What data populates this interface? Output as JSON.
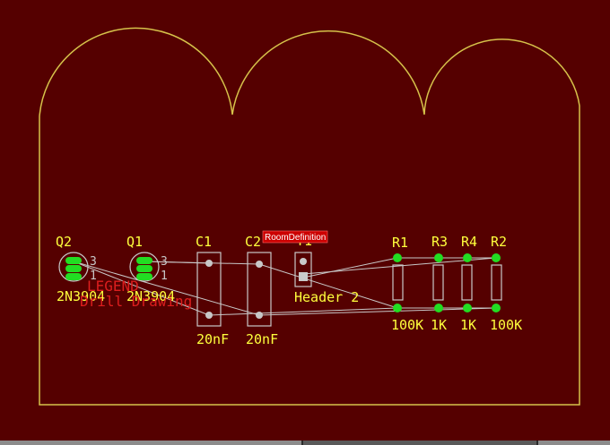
{
  "colors": {
    "background": "#550000",
    "board_outline": "#d6c24a",
    "silkscreen": "#ffff3c",
    "pad_green": "#22dd22",
    "pad_grey": "#c8c8c8",
    "trace": "#c8c8c8",
    "legend_red": "#dd1e1e",
    "tag_bg": "#cc0000"
  },
  "tooltip": {
    "label": "RoomDefinition"
  },
  "components": {
    "q2": {
      "designator": "Q2",
      "value": "2N3904",
      "pin_top": "3",
      "pin_bottom": "1"
    },
    "q1": {
      "designator": "Q1",
      "value": "2N3904",
      "pin_top": "3",
      "pin_bottom": "1"
    },
    "c1": {
      "designator": "C1",
      "value": "20nF"
    },
    "c2": {
      "designator": "C2",
      "value": "20nF"
    },
    "t1": {
      "designator": "T1",
      "value": "Header 2"
    },
    "r1": {
      "designator": "R1",
      "value": "100K"
    },
    "r3": {
      "designator": "R3",
      "value": "1K"
    },
    "r4": {
      "designator": "R4",
      "value": "1K"
    },
    "r2": {
      "designator": "R2",
      "value": "100K"
    }
  },
  "legend": {
    "line1": "LEGEND",
    "line2": "Drill Drawing"
  }
}
